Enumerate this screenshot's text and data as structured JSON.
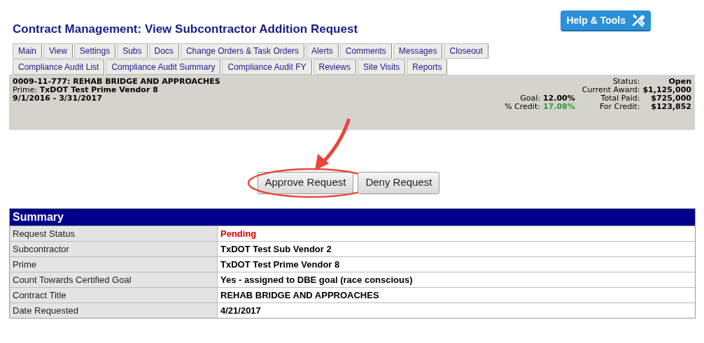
{
  "page_title": "Contract Management: View Subcontractor Addition Request",
  "help_button": "Help & Tools",
  "tab_rows": [
    [
      {
        "label": "Main",
        "selected": false
      },
      {
        "label": "View",
        "selected": false
      },
      {
        "label": "Settings",
        "selected": false
      },
      {
        "label": "Subs",
        "selected": false
      },
      {
        "label": "Docs",
        "selected": false
      },
      {
        "label": "Change Orders & Task Orders",
        "selected": false
      },
      {
        "label": "Alerts",
        "selected": false
      },
      {
        "label": "Comments",
        "selected": false
      },
      {
        "label": "Messages",
        "selected": false
      },
      {
        "label": "Closeout",
        "selected": false
      }
    ],
    [
      {
        "label": "Compliance Audit List",
        "selected": false
      },
      {
        "label": "Compliance Audit Summary",
        "selected": false
      },
      {
        "label": "Compliance Audit FY",
        "selected": false
      },
      {
        "label": "Reviews",
        "selected": false
      },
      {
        "label": "Site Visits",
        "selected": false
      },
      {
        "label": "Reports",
        "selected": false
      }
    ]
  ],
  "contract": {
    "title": "0009-11-777: REHAB BRIDGE AND APPROACHES",
    "prime_label": "Prime:",
    "prime": "TxDOT Test Prime Vendor 8",
    "dates": "9/1/2016 - 3/31/2017",
    "goal_stats": [
      {
        "label": "Goal:",
        "value": "12.00%",
        "kind": "plain"
      },
      {
        "label": "% Credit:",
        "value": "17.08%",
        "kind": "good"
      }
    ],
    "award_stats": [
      {
        "label": "Status:",
        "value": "Open"
      },
      {
        "label": "Current Award:",
        "value": "$1,125,000"
      },
      {
        "label": "Total Paid:",
        "value": "$725,000"
      },
      {
        "label": "For Credit:",
        "value": "$123,852"
      }
    ]
  },
  "buttons": [
    {
      "label": "Approve Request",
      "highlighted": true
    },
    {
      "label": "Deny Request",
      "highlighted": false
    }
  ],
  "summary": {
    "title": "Summary",
    "rows": [
      {
        "label": "Request Status",
        "value": "Pending",
        "kind": "status"
      },
      {
        "label": "Subcontractor",
        "value": "TxDOT Test Sub Vendor 2",
        "kind": "plain"
      },
      {
        "label": "Prime",
        "value": "TxDOT Test Prime Vendor 8",
        "kind": "plain"
      },
      {
        "label": "Count Towards Certified Goal",
        "value": "Yes - assigned to DBE goal (race conscious)",
        "kind": "plain"
      },
      {
        "label": "Contract Title",
        "value": "REHAB BRIDGE AND APPROACHES",
        "kind": "plain"
      },
      {
        "label": "Date Requested",
        "value": "4/21/2017",
        "kind": "plain"
      }
    ]
  }
}
